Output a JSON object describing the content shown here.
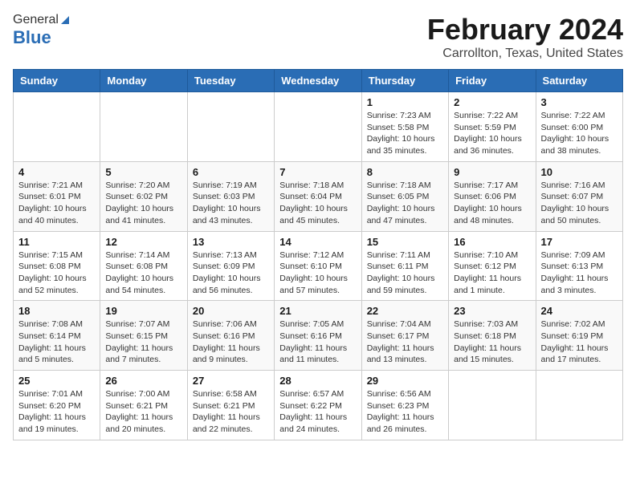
{
  "header": {
    "logo_general": "General",
    "logo_blue": "Blue",
    "title": "February 2024",
    "subtitle": "Carrollton, Texas, United States"
  },
  "days_of_week": [
    "Sunday",
    "Monday",
    "Tuesday",
    "Wednesday",
    "Thursday",
    "Friday",
    "Saturday"
  ],
  "weeks": [
    [
      {
        "day": "",
        "info": ""
      },
      {
        "day": "",
        "info": ""
      },
      {
        "day": "",
        "info": ""
      },
      {
        "day": "",
        "info": ""
      },
      {
        "day": "1",
        "info": "Sunrise: 7:23 AM\nSunset: 5:58 PM\nDaylight: 10 hours\nand 35 minutes."
      },
      {
        "day": "2",
        "info": "Sunrise: 7:22 AM\nSunset: 5:59 PM\nDaylight: 10 hours\nand 36 minutes."
      },
      {
        "day": "3",
        "info": "Sunrise: 7:22 AM\nSunset: 6:00 PM\nDaylight: 10 hours\nand 38 minutes."
      }
    ],
    [
      {
        "day": "4",
        "info": "Sunrise: 7:21 AM\nSunset: 6:01 PM\nDaylight: 10 hours\nand 40 minutes."
      },
      {
        "day": "5",
        "info": "Sunrise: 7:20 AM\nSunset: 6:02 PM\nDaylight: 10 hours\nand 41 minutes."
      },
      {
        "day": "6",
        "info": "Sunrise: 7:19 AM\nSunset: 6:03 PM\nDaylight: 10 hours\nand 43 minutes."
      },
      {
        "day": "7",
        "info": "Sunrise: 7:18 AM\nSunset: 6:04 PM\nDaylight: 10 hours\nand 45 minutes."
      },
      {
        "day": "8",
        "info": "Sunrise: 7:18 AM\nSunset: 6:05 PM\nDaylight: 10 hours\nand 47 minutes."
      },
      {
        "day": "9",
        "info": "Sunrise: 7:17 AM\nSunset: 6:06 PM\nDaylight: 10 hours\nand 48 minutes."
      },
      {
        "day": "10",
        "info": "Sunrise: 7:16 AM\nSunset: 6:07 PM\nDaylight: 10 hours\nand 50 minutes."
      }
    ],
    [
      {
        "day": "11",
        "info": "Sunrise: 7:15 AM\nSunset: 6:08 PM\nDaylight: 10 hours\nand 52 minutes."
      },
      {
        "day": "12",
        "info": "Sunrise: 7:14 AM\nSunset: 6:08 PM\nDaylight: 10 hours\nand 54 minutes."
      },
      {
        "day": "13",
        "info": "Sunrise: 7:13 AM\nSunset: 6:09 PM\nDaylight: 10 hours\nand 56 minutes."
      },
      {
        "day": "14",
        "info": "Sunrise: 7:12 AM\nSunset: 6:10 PM\nDaylight: 10 hours\nand 57 minutes."
      },
      {
        "day": "15",
        "info": "Sunrise: 7:11 AM\nSunset: 6:11 PM\nDaylight: 10 hours\nand 59 minutes."
      },
      {
        "day": "16",
        "info": "Sunrise: 7:10 AM\nSunset: 6:12 PM\nDaylight: 11 hours\nand 1 minute."
      },
      {
        "day": "17",
        "info": "Sunrise: 7:09 AM\nSunset: 6:13 PM\nDaylight: 11 hours\nand 3 minutes."
      }
    ],
    [
      {
        "day": "18",
        "info": "Sunrise: 7:08 AM\nSunset: 6:14 PM\nDaylight: 11 hours\nand 5 minutes."
      },
      {
        "day": "19",
        "info": "Sunrise: 7:07 AM\nSunset: 6:15 PM\nDaylight: 11 hours\nand 7 minutes."
      },
      {
        "day": "20",
        "info": "Sunrise: 7:06 AM\nSunset: 6:16 PM\nDaylight: 11 hours\nand 9 minutes."
      },
      {
        "day": "21",
        "info": "Sunrise: 7:05 AM\nSunset: 6:16 PM\nDaylight: 11 hours\nand 11 minutes."
      },
      {
        "day": "22",
        "info": "Sunrise: 7:04 AM\nSunset: 6:17 PM\nDaylight: 11 hours\nand 13 minutes."
      },
      {
        "day": "23",
        "info": "Sunrise: 7:03 AM\nSunset: 6:18 PM\nDaylight: 11 hours\nand 15 minutes."
      },
      {
        "day": "24",
        "info": "Sunrise: 7:02 AM\nSunset: 6:19 PM\nDaylight: 11 hours\nand 17 minutes."
      }
    ],
    [
      {
        "day": "25",
        "info": "Sunrise: 7:01 AM\nSunset: 6:20 PM\nDaylight: 11 hours\nand 19 minutes."
      },
      {
        "day": "26",
        "info": "Sunrise: 7:00 AM\nSunset: 6:21 PM\nDaylight: 11 hours\nand 20 minutes."
      },
      {
        "day": "27",
        "info": "Sunrise: 6:58 AM\nSunset: 6:21 PM\nDaylight: 11 hours\nand 22 minutes."
      },
      {
        "day": "28",
        "info": "Sunrise: 6:57 AM\nSunset: 6:22 PM\nDaylight: 11 hours\nand 24 minutes."
      },
      {
        "day": "29",
        "info": "Sunrise: 6:56 AM\nSunset: 6:23 PM\nDaylight: 11 hours\nand 26 minutes."
      },
      {
        "day": "",
        "info": ""
      },
      {
        "day": "",
        "info": ""
      }
    ]
  ]
}
